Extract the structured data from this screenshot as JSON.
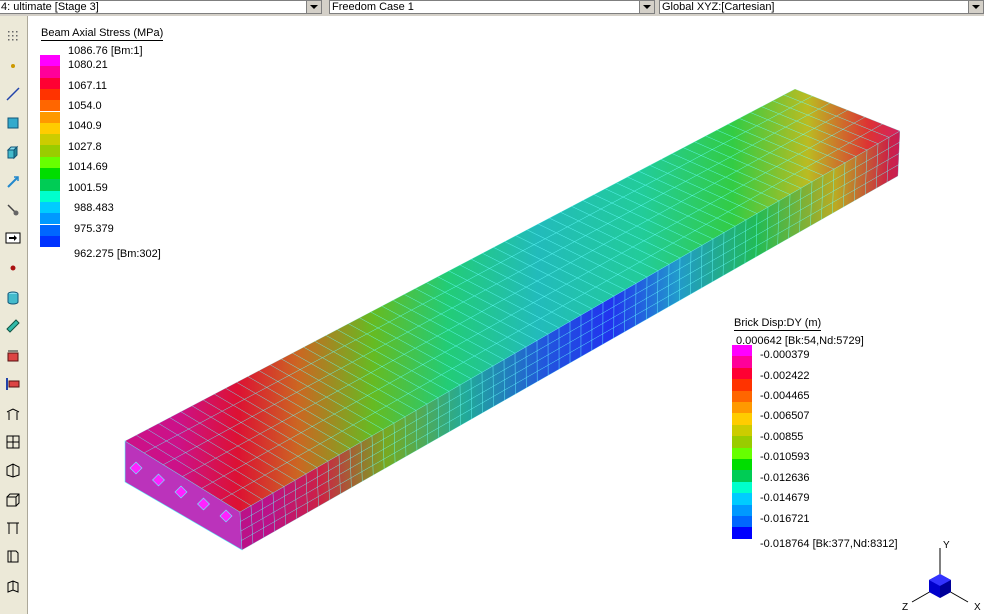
{
  "header": {
    "stage_select": "4: ultimate [Stage 3]",
    "case_select": "Freedom Case 1",
    "coord_select": "Global XYZ:[Cartesian]"
  },
  "toolbar": {
    "icons": [
      "grid-dots-icon",
      "node-point-icon",
      "beam-line-icon",
      "plate-square-icon",
      "brick-cube-icon",
      "link-icon",
      "connection-icon",
      "arrow-right-icon",
      "red-dot-icon",
      "cylinder-icon",
      "ruler-icon",
      "plate-load-icon",
      "beam-load-icon",
      "frame-icon",
      "grid-icon",
      "isometric-frame-icon",
      "box-frame-icon",
      "portal-frame-icon",
      "sheet-icon",
      "folded-sheet-icon"
    ]
  },
  "beam_legend": {
    "title": "Beam Axial Stress  (MPa)",
    "labels": [
      "1086.76 [Bm:1]",
      "1080.21",
      "1067.11",
      "1054.0",
      "1040.9",
      "1027.8",
      "1014.69",
      "1001.59",
      "988.483",
      "975.379",
      "962.275 [Bm:302]"
    ],
    "colors": [
      "#ff00ff",
      "#ff0099",
      "#ff0033",
      "#ff3300",
      "#ff6600",
      "#ff9900",
      "#ffcc00",
      "#cccc00",
      "#99cc00",
      "#66ff00",
      "#00dd00",
      "#00cc55",
      "#00ffcc",
      "#00ccff",
      "#0099ff",
      "#0066ff",
      "#0033ff"
    ]
  },
  "brick_legend": {
    "title": "Brick Disp:DY  (m)",
    "labels": [
      "0.000642 [Bk:54,Nd:5729]",
      "-0.000379",
      "-0.002422",
      "-0.004465",
      "-0.006507",
      "-0.00855",
      "-0.010593",
      "-0.012636",
      "-0.014679",
      "-0.016721",
      "-0.018764 [Bk:377,Nd:8312]"
    ],
    "colors": [
      "#ff00ff",
      "#ff0099",
      "#ff0033",
      "#ff3300",
      "#ff6600",
      "#ff9900",
      "#ffcc00",
      "#cccc00",
      "#99cc00",
      "#66ff00",
      "#00dd00",
      "#00cc55",
      "#00ffcc",
      "#00ccff",
      "#0099ff",
      "#0066ff",
      "#0000ff"
    ]
  },
  "axes": {
    "x": "X",
    "y": "Y",
    "z": "Z"
  }
}
